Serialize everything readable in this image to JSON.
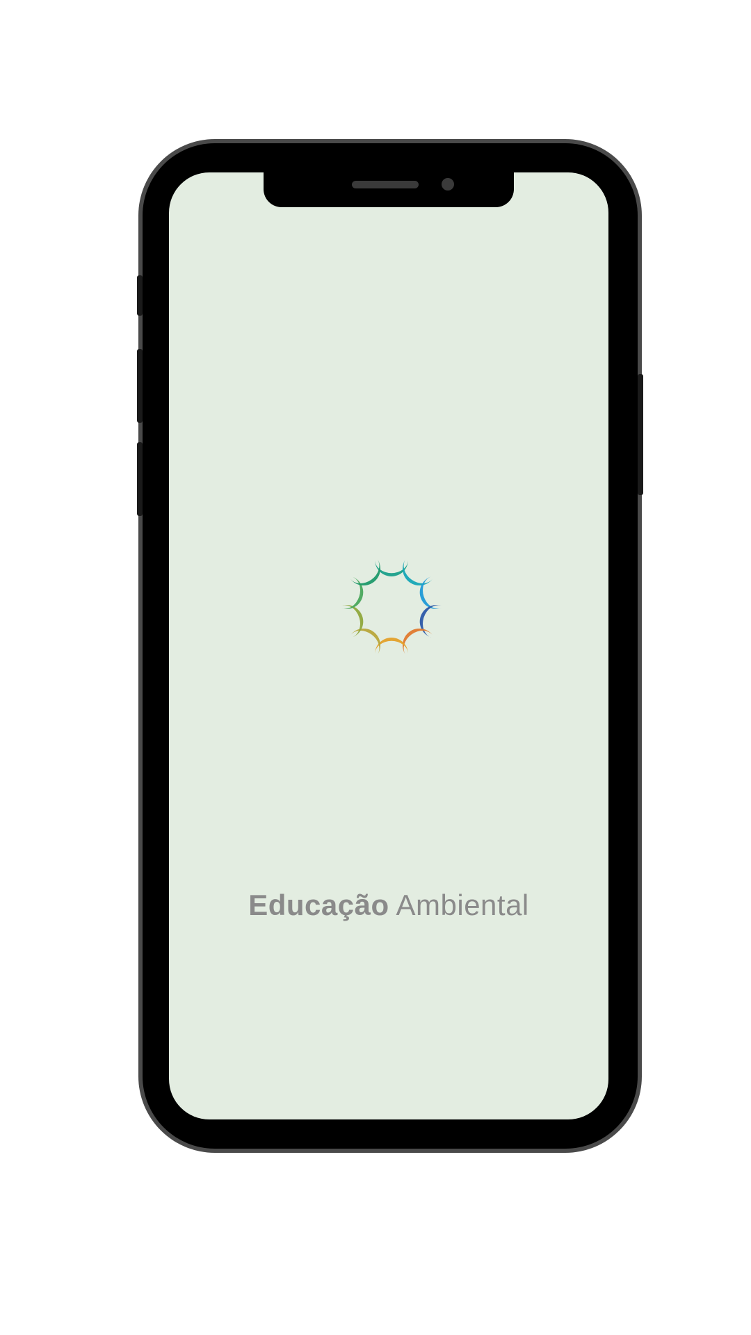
{
  "app": {
    "title_bold": "Educação",
    "title_light": "Ambiental"
  },
  "logo": {
    "icon": "circular-leaf-logo-icon",
    "colors": [
      "#1aa08a",
      "#16a7b6",
      "#1f9ad6",
      "#2c5aa8",
      "#e07a2e",
      "#e3a12a",
      "#b8a63a",
      "#8fa83c",
      "#4aa85c",
      "#1f9a6a"
    ]
  },
  "screen": {
    "background": "#e3ede1"
  }
}
